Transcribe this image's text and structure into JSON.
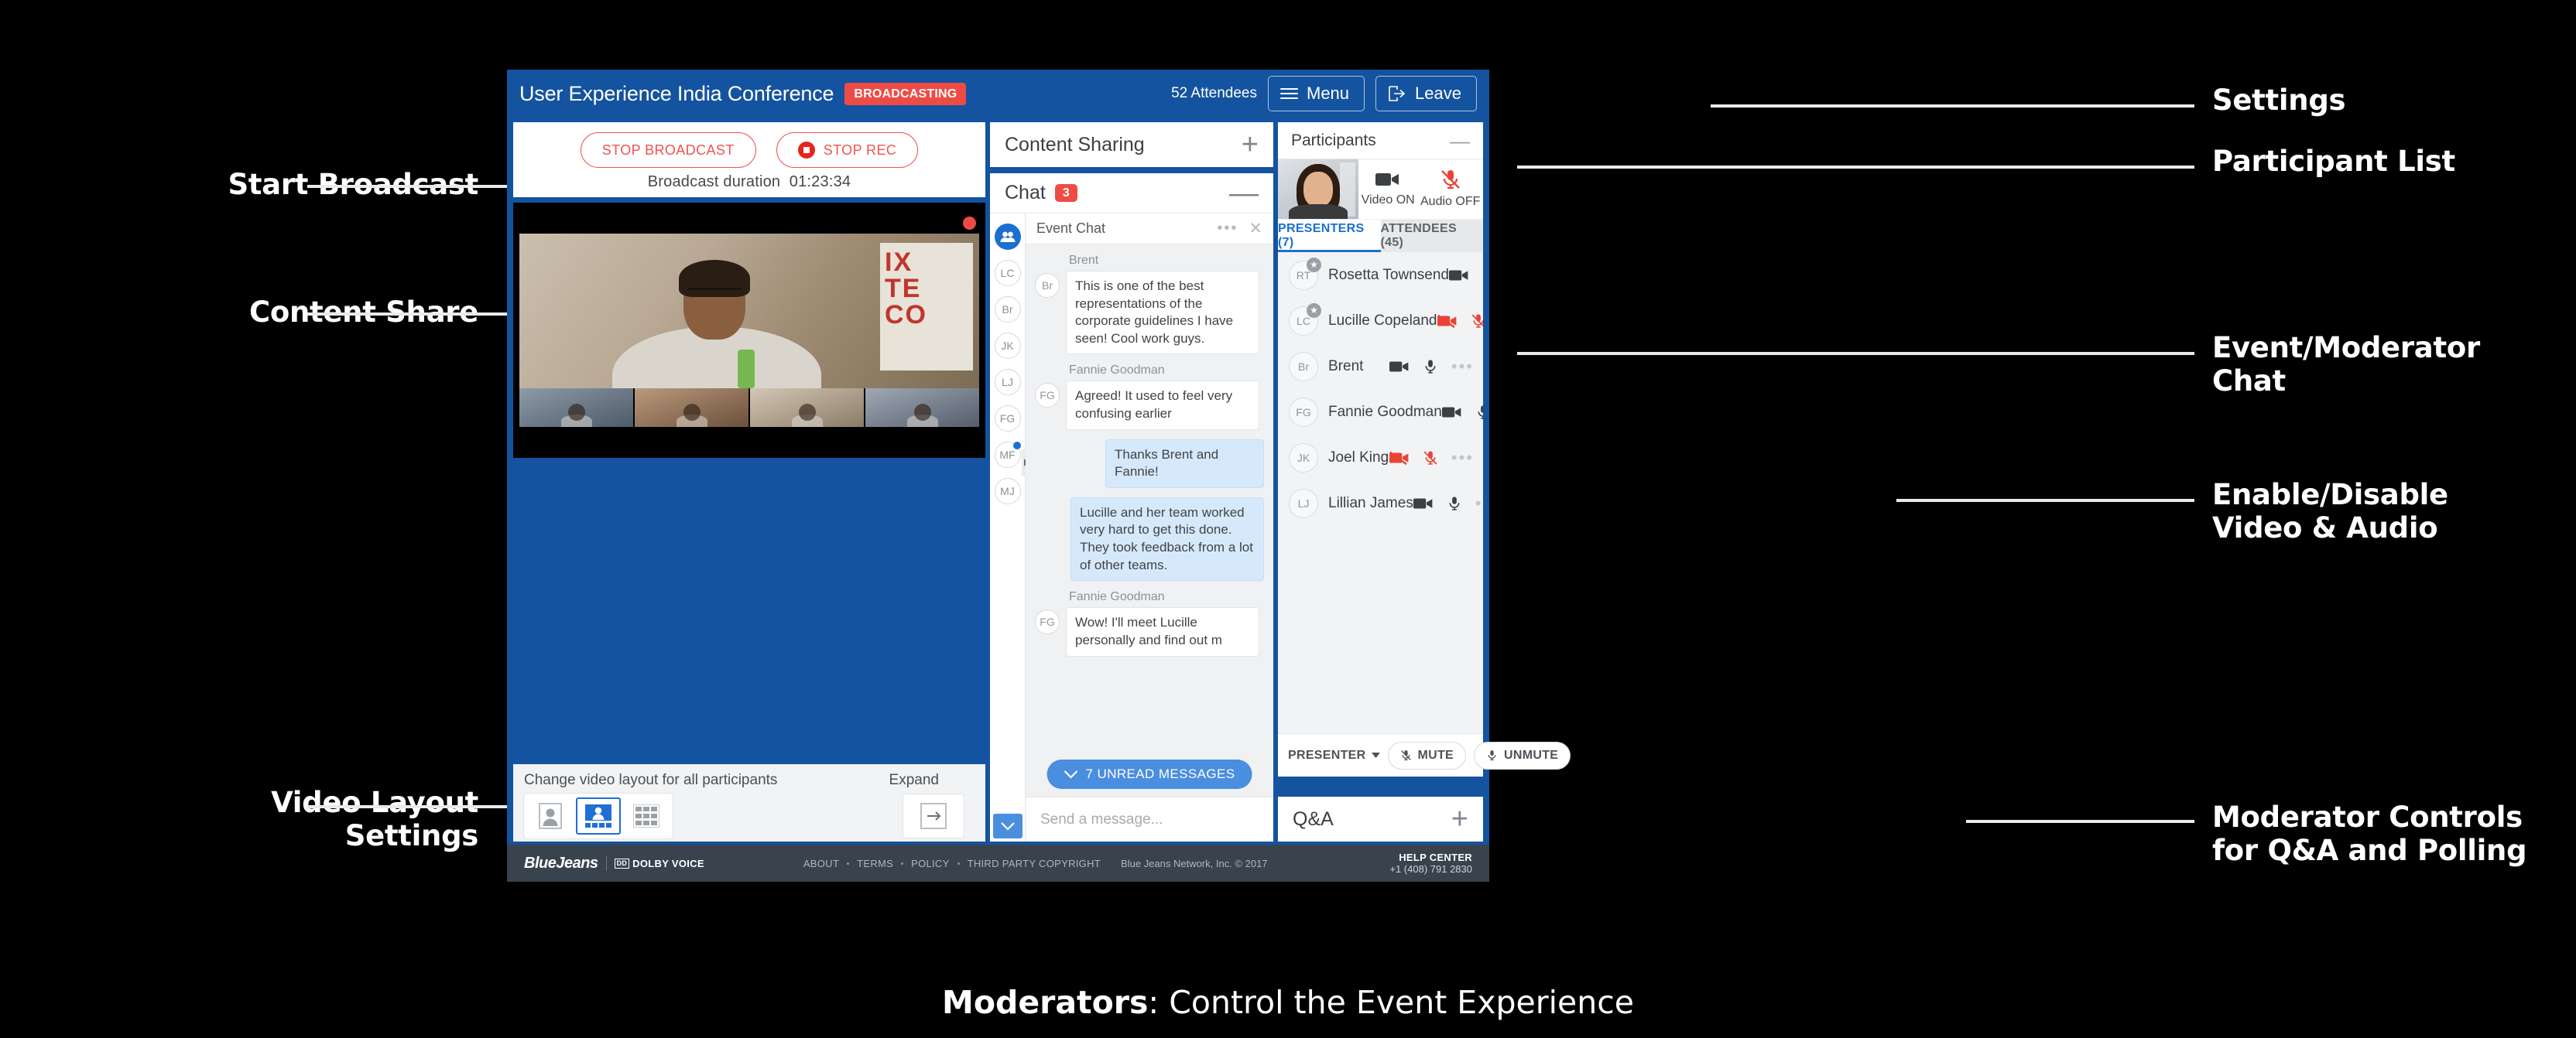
{
  "annotations": {
    "left": [
      {
        "text": "Start Broadcast"
      },
      {
        "text": "Content Share"
      },
      {
        "text": "Video Layout\nSettings"
      }
    ],
    "right": [
      {
        "text": "Settings"
      },
      {
        "text": "Participant List"
      },
      {
        "text": "Event/Moderator\nChat"
      },
      {
        "text": "Enable/Disable\nVideo & Audio"
      },
      {
        "text": "Moderator Controls\nfor Q&A and Polling"
      }
    ]
  },
  "caption": {
    "bold": "Moderators",
    "rest": ": Control the Event Experience"
  },
  "titlebar": {
    "event_title": "User Experience India Conference",
    "status_badge": "BROADCASTING",
    "attendee_count": "52 Attendees",
    "menu_label": "Menu",
    "leave_label": "Leave"
  },
  "broadcast": {
    "stop_broadcast_label": "STOP BROADCAST",
    "stop_rec_label": "STOP REC",
    "duration_label": "Broadcast duration",
    "duration_value": "01:23:34"
  },
  "video_sign": {
    "l1": "IX",
    "l2": "TE",
    "l3": "CO"
  },
  "layout": {
    "title": "Change video layout for all participants",
    "expand_label": "Expand",
    "options": [
      {
        "name": "single-speaker",
        "selected": false
      },
      {
        "name": "speaker-with-filmstrip",
        "selected": true
      },
      {
        "name": "grid",
        "selected": false
      }
    ]
  },
  "content_sharing": {
    "title": "Content Sharing",
    "action": "+"
  },
  "chat": {
    "title": "Chat",
    "unread_badge": "3",
    "minimize": "—",
    "conversation_title": "Event Chat",
    "rail": [
      {
        "initials": "",
        "type": "group"
      },
      {
        "initials": "LC",
        "type": "person"
      },
      {
        "initials": "Br",
        "type": "person"
      },
      {
        "initials": "JK",
        "type": "person"
      },
      {
        "initials": "LJ",
        "type": "person"
      },
      {
        "initials": "FG",
        "type": "person"
      },
      {
        "initials": "MF",
        "type": "person",
        "unread": true
      },
      {
        "initials": "MJ",
        "type": "person"
      }
    ],
    "messages": [
      {
        "sender": "Brent",
        "initials": "Br",
        "text": "This is one of the best representations of the corporate guidelines I have seen! Cool work guys.",
        "outgoing": false
      },
      {
        "sender": "Fannie Goodman",
        "initials": "FG",
        "text": "Agreed! It used to feel very confusing earlier",
        "outgoing": false
      },
      {
        "sender": "",
        "initials": "",
        "text": "Thanks Brent and Fannie!",
        "outgoing": true,
        "short": true
      },
      {
        "sender": "",
        "initials": "",
        "text": "Lucille and her team worked very hard to get this done. They took feedback from a lot of other teams.",
        "outgoing": true
      },
      {
        "sender": "Fannie Goodman",
        "initials": "FG",
        "text": "Wow! I'll meet Lucille personally and find out m",
        "outgoing": false
      }
    ],
    "unread_pill": "7 UNREAD MESSAGES",
    "input_placeholder": "Send a message..."
  },
  "participants": {
    "title": "Participants",
    "minimize": "—",
    "self_video_label": "Video ON",
    "self_audio_label": "Audio OFF",
    "tabs": [
      {
        "label": "PRESENTERS (7)",
        "active": true
      },
      {
        "label": "ATTENDEES (45)",
        "active": false
      }
    ],
    "list": [
      {
        "initials": "RT",
        "name": "Rosetta Townsend",
        "moderator": true,
        "video": "on",
        "audio": "muted"
      },
      {
        "initials": "LC",
        "name": "Lucille Copeland",
        "moderator": true,
        "video": "off",
        "audio": "muted"
      },
      {
        "initials": "Br",
        "name": "Brent",
        "moderator": false,
        "video": "on",
        "audio": "on"
      },
      {
        "initials": "FG",
        "name": "Fannie Goodman",
        "moderator": false,
        "video": "on",
        "audio": "on"
      },
      {
        "initials": "JK",
        "name": "Joel King",
        "moderator": false,
        "video": "off",
        "audio": "muted"
      },
      {
        "initials": "LJ",
        "name": "Lillian James",
        "moderator": false,
        "video": "on",
        "audio": "on"
      }
    ],
    "role_selector": "PRESENTER",
    "mute_label": "MUTE",
    "unmute_label": "UNMUTE"
  },
  "qa": {
    "title": "Q&A",
    "action": "+"
  },
  "footer": {
    "brand": "BlueJeans",
    "dolby": "DOLBY VOICE",
    "dolby_mark": "DD",
    "links": [
      "ABOUT",
      "TERMS",
      "POLICY",
      "THIRD PARTY COPYRIGHT"
    ],
    "copyright": "Blue Jeans Network, Inc. © 2017",
    "help_title": "HELP CENTER",
    "help_phone": "+1 (408) 791 2830"
  },
  "colors": {
    "app_blue": "#14539f",
    "accent_red": "#ef4b45",
    "link_blue": "#1b6fd0",
    "footer_bg": "#39434e"
  }
}
